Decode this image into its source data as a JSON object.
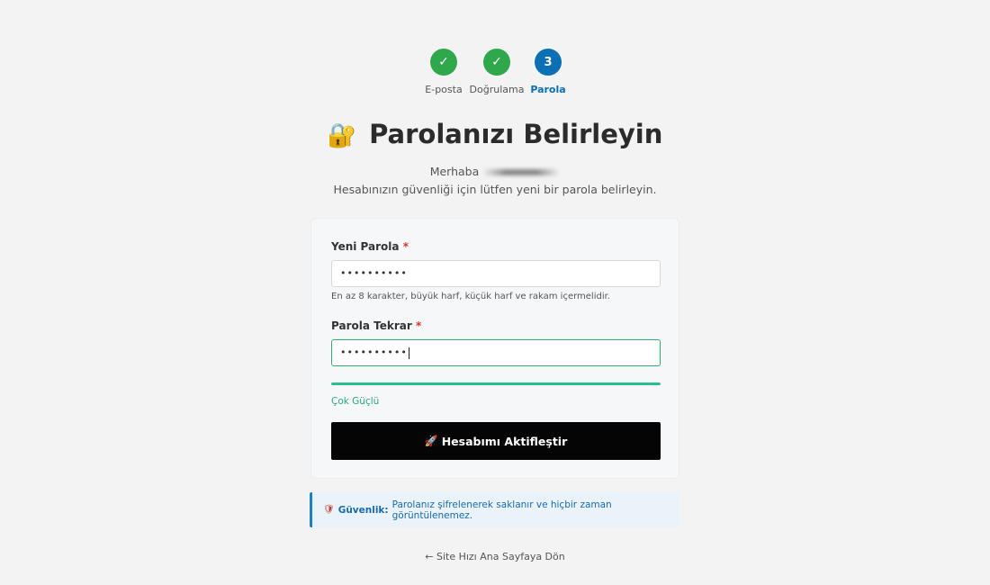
{
  "stepper": {
    "steps": [
      {
        "label": "E-posta",
        "marker": "✓",
        "state": "done"
      },
      {
        "label": "Doğrulama",
        "marker": "✓",
        "state": "done"
      },
      {
        "label": "Parola",
        "marker": "3",
        "state": "active"
      }
    ]
  },
  "header": {
    "icon": "🔐",
    "title": "Parolanızı Belirleyin",
    "greeting": "Merhaba",
    "subtitle": "Hesabınızın güvenliği için lütfen yeni bir parola belirleyin."
  },
  "form": {
    "new_password": {
      "label": "Yeni Parola",
      "required_mark": "*",
      "value": "••••••••••",
      "help": "En az 8 karakter, büyük harf, küçük harf ve rakam içermelidir."
    },
    "confirm_password": {
      "label": "Parola Tekrar",
      "required_mark": "*",
      "value": "••••••••••"
    },
    "strength": {
      "label": "Çok Güçlü",
      "level": 1.0,
      "color": "#27c08d"
    },
    "submit": {
      "icon": "🚀",
      "label": "Hesabımı Aktifleştir"
    }
  },
  "info": {
    "icon": "🛡",
    "title": "Güvenlik:",
    "text": "Parolanız şifrelenerek saklanır ve hiçbir zaman görüntülenemez."
  },
  "footer": {
    "back_link": "← Site Hızı Ana Sayfaya Dön"
  },
  "colors": {
    "step_done": "#2ea84a",
    "step_active": "#0b6fb3",
    "button_bg": "#050505",
    "info_accent": "#1e7fc4"
  }
}
